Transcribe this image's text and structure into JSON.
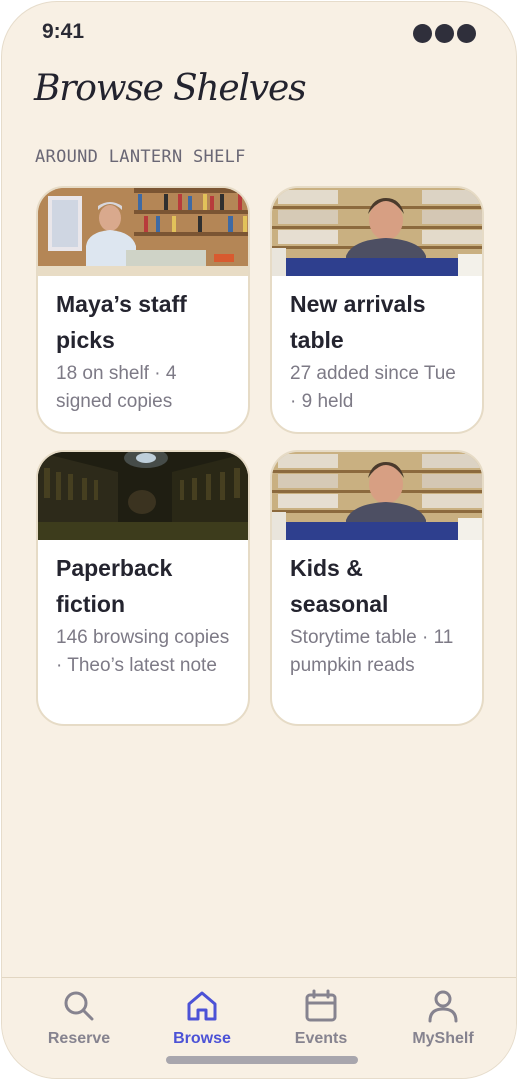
{
  "status": {
    "time": "9:41"
  },
  "header": {
    "title": "Browse Shelves",
    "section_label": "AROUND LANTERN SHELF"
  },
  "cards": [
    {
      "title": "Maya’s staff picks",
      "meta": "18 on shelf · 4 signed copies",
      "image": "staff-picks-photo"
    },
    {
      "title": "New arrivals table",
      "meta": "27 added since Tue · 9 held",
      "image": "new-arrivals-photo"
    },
    {
      "title": "Paperback fiction",
      "meta": "146 browsing copies · Theo’s latest note",
      "image": "paperback-fiction-photo"
    },
    {
      "title": "Kids & seasonal",
      "meta": "Storytime table · 11 pumpkin reads",
      "image": "kids-seasonal-photo"
    }
  ],
  "tabs": [
    {
      "label": "Reserve",
      "icon": "search-icon",
      "active": false
    },
    {
      "label": "Browse",
      "icon": "home-icon",
      "active": true
    },
    {
      "label": "Events",
      "icon": "calendar-icon",
      "active": false
    },
    {
      "label": "MyShelf",
      "icon": "person-icon",
      "active": false
    }
  ],
  "colors": {
    "background": "#f8f0e4",
    "accent": "#4c52d6",
    "inactive_tab": "#86838f",
    "card_border": "#e6dbc6"
  }
}
